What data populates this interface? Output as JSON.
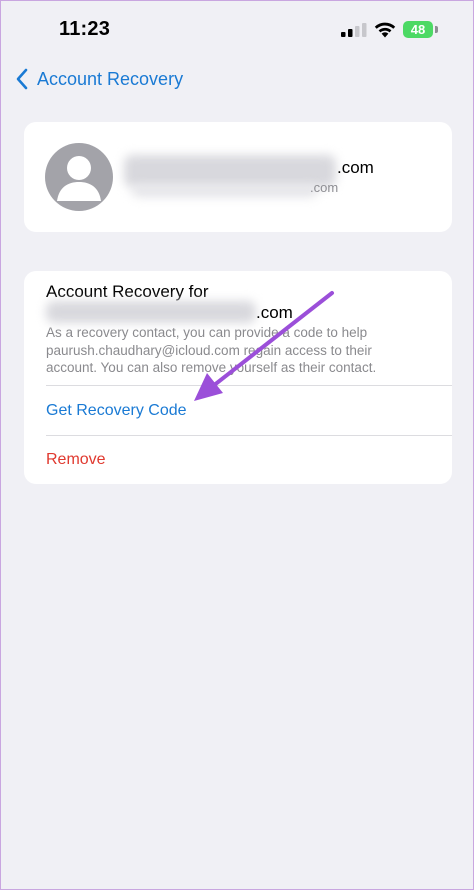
{
  "status_bar": {
    "time": "11:23",
    "battery": "48"
  },
  "nav": {
    "back_label": "Account Recovery"
  },
  "profile": {
    "email_suffix": ".com",
    "email_sub_suffix": ".com"
  },
  "recovery": {
    "title": "Account Recovery for",
    "contact_email_suffix": ".com",
    "description": "As a recovery contact, you can provide a code to help paurush.chaudhary@icloud.com regain access to their account. You can also remove yourself as their contact.",
    "get_code_label": "Get Recovery Code",
    "remove_label": "Remove"
  },
  "colors": {
    "accent": "#1a7ad4",
    "destructive": "#e0392f",
    "battery": "#4cd964",
    "annotation": "#9b4fd9"
  },
  "icons": {
    "back": "chevron-left-icon",
    "signal": "cellular-signal-icon",
    "wifi": "wifi-icon",
    "avatar": "person-icon"
  }
}
